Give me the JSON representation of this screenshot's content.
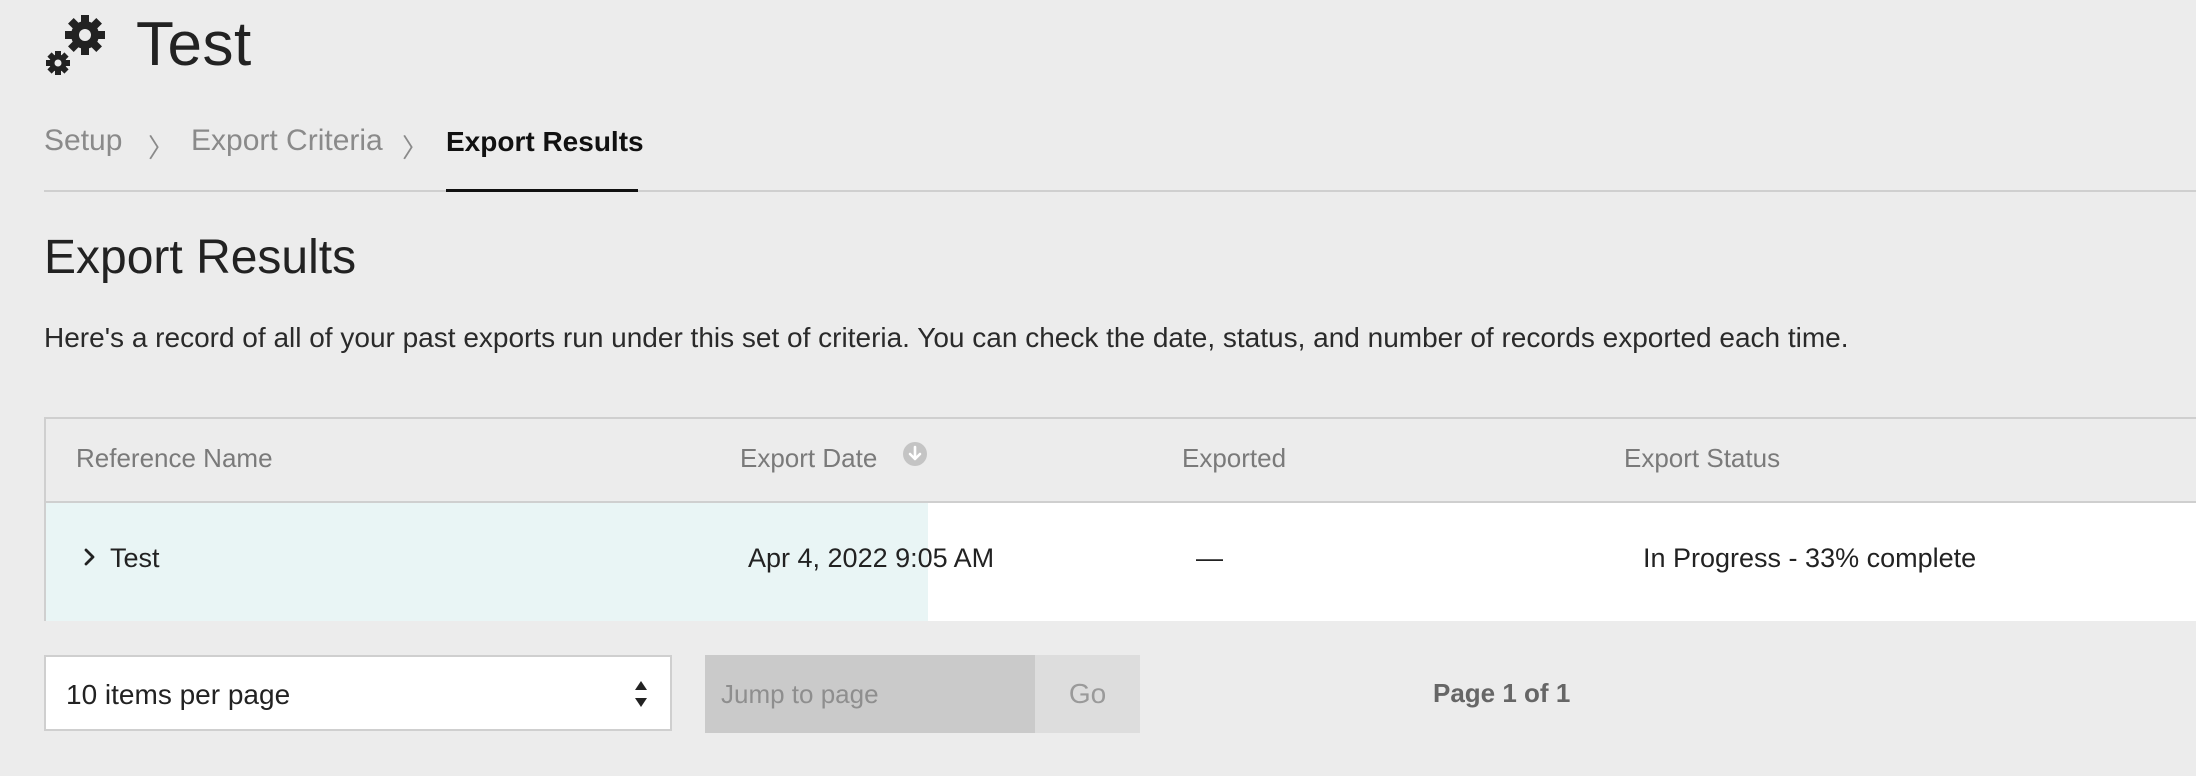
{
  "app": {
    "title": "Test",
    "icon": "gears-icon"
  },
  "steps": [
    {
      "label": "Setup",
      "active": false
    },
    {
      "label": "Export Criteria",
      "active": false
    },
    {
      "label": "Export Results",
      "active": true
    }
  ],
  "section": {
    "title": "Export Results",
    "description": "Here's a record of all of your past exports run under this set of criteria. You can check the date, status, and number of records exported each time."
  },
  "table": {
    "columns": [
      "Reference Name",
      "Export Date",
      "Exported",
      "Export Status"
    ],
    "sort_icon": "sort-down-circle-icon",
    "rows": [
      {
        "reference_name": "Test",
        "export_date": "Apr 4, 2022 9:05 AM",
        "exported": "—",
        "export_status": "In Progress - 33% complete"
      }
    ]
  },
  "pagination": {
    "per_page_label": "10 items per page",
    "jump_placeholder": "Jump to page",
    "go_label": "Go",
    "page_info": "Page 1 of 1"
  },
  "colors": {
    "background": "#ececec",
    "row_highlight": "#e9f5f5",
    "active_step": "#111111"
  }
}
